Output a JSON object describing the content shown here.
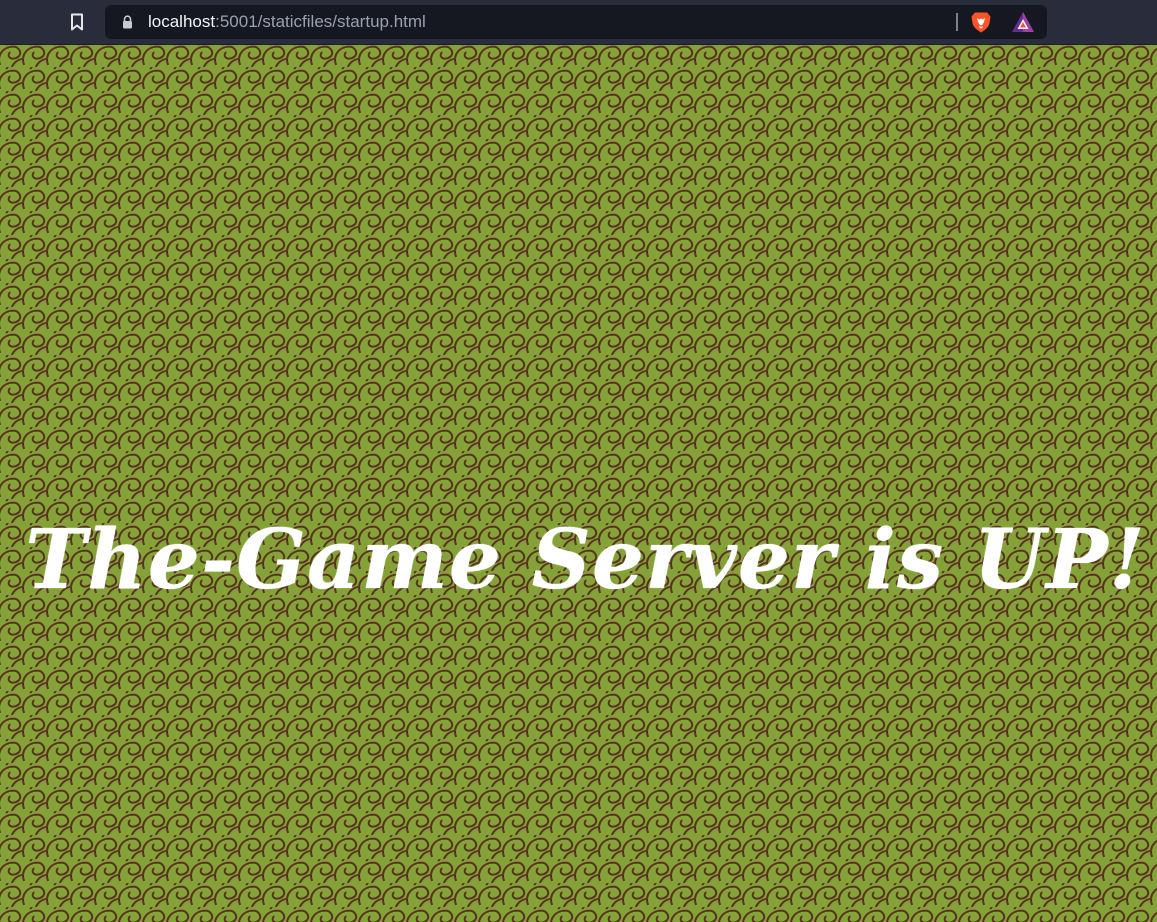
{
  "browser": {
    "url_host": "localhost",
    "url_path": ":5001/staticfiles/startup.html",
    "icons": {
      "bookmark": "bookmark-icon",
      "lock": "lock-icon",
      "shields": "brave-shields-icon",
      "rewards": "brave-rewards-icon"
    }
  },
  "page": {
    "headline": "The-Game Server is UP!"
  },
  "colors": {
    "background": "#84a238",
    "pattern_stroke": "#5a3220",
    "headline": "#ffffff",
    "chrome": "#292c3a",
    "address_bar": "#161821",
    "brave_orange": "#fb542b",
    "rewards_purple": "#662d91"
  }
}
